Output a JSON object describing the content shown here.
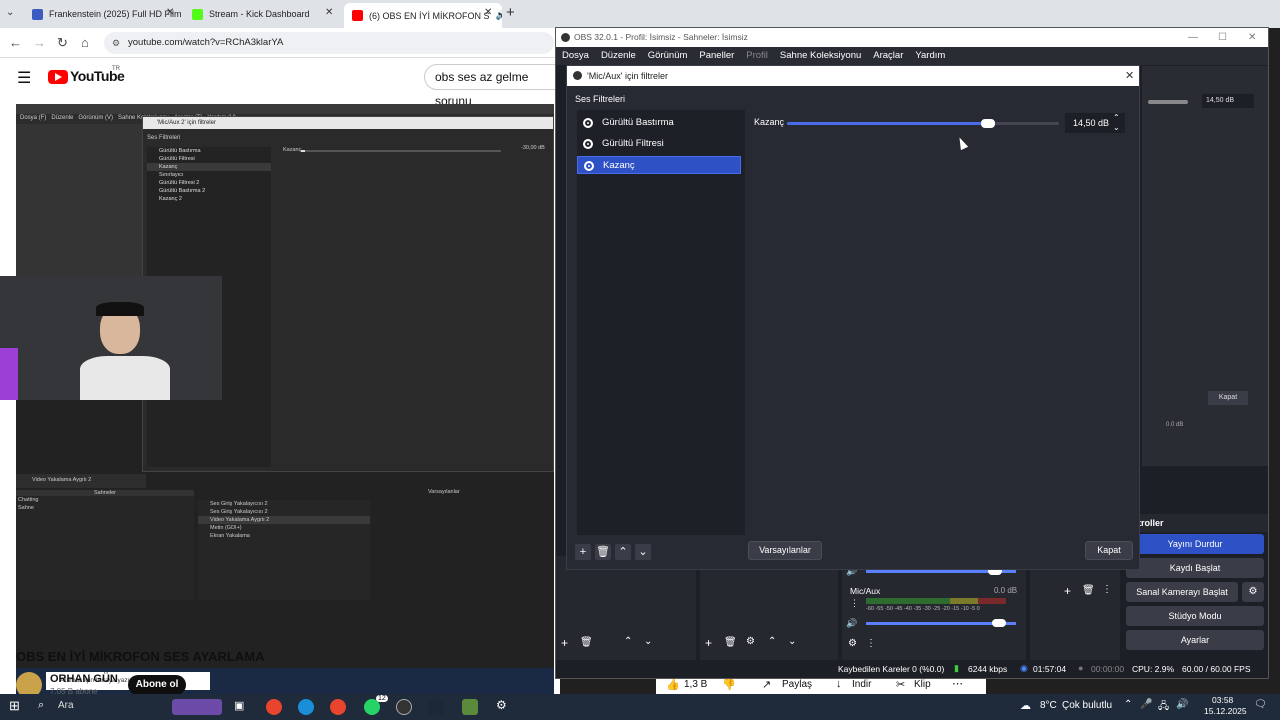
{
  "browser": {
    "tabs": [
      {
        "title": "Frankenstein (2025) Full HD Film",
        "color": "#3a5bbf"
      },
      {
        "title": "Stream - Kick Dashboard",
        "color": "#53fc18"
      },
      {
        "title": "(6) OBS EN İYİ MİKROFON S",
        "color": "#ff0000"
      }
    ],
    "url": "youtube.com/watch?v=RChA3klarYA"
  },
  "youtube": {
    "logo": "YouTube",
    "region": "TR",
    "search_value": "obs ses az gelme sorunu",
    "video_title": "OBS EN İYİ MİKROFON SES AYARLAMA",
    "channel_name": "ORHAN GÜN",
    "channel_subs": "7,05 B abone",
    "subscribe_label": "Abone ol",
    "likes": "1,3 B",
    "share_label": "Paylaş",
    "download_label": "İndir",
    "clip_label": "Klip",
    "video_inner": {
      "dialog_title": "'Mic/Aux 2' için filtreler",
      "section": "Ses Filtreleri",
      "filters": [
        "Gürültü Bastırma",
        "Gürültü Filtresi",
        "Kazanç",
        "Sınırlayıcı",
        "Gürültü Filtresi 2",
        "Gürültü Bastırma 2",
        "Kazanç 2"
      ],
      "gain_label": "Kazanç",
      "gain_value": "-30,00 dB",
      "scene_label": "Video Yakalama Aygıtı 2",
      "scenes_header": "Sahneler",
      "scenes": [
        "Chatting",
        "Sahne"
      ],
      "sources": [
        "Ses Giriş Yakalayıcısı 2",
        "Ses Giriş Yakalayıcısı 2",
        "Video Yakalama Aygıtı 2",
        "Metin (GDI+)",
        "Ekran Yakalama"
      ],
      "defaults_label": "Varsayılanlar",
      "close_label": "Kapat",
      "taskbar_search": "Aramak için buraya yazın"
    }
  },
  "obs": {
    "window_title": "OBS 32.0.1 - Profil: İsimsiz - Sahneler: İsimsiz",
    "menu": [
      "Dosya",
      "Düzenle",
      "Görünüm",
      "Paneller",
      "Profil",
      "Sahne Koleksiyonu",
      "Araçlar",
      "Yardım"
    ],
    "dialog": {
      "title": "'Mic/Aux' için filtreler",
      "section_label": "Ses Filtreleri",
      "filters": [
        {
          "name": "Gürültü Bastırma",
          "selected": false
        },
        {
          "name": "Gürültü Filtresi",
          "selected": false
        },
        {
          "name": "Kazanç",
          "selected": true
        }
      ],
      "gain_label": "Kazanç",
      "gain_value": "14,50 dB",
      "gain_fraction": 0.74,
      "defaults_label": "Varsayılanlar",
      "close_label": "Kapat"
    },
    "mixer": {
      "track_name": "Mic/Aux",
      "track_db": "0.0 dB",
      "scale": "-60 -55 -50 -45 -40 -35 -30 -25 -20 -15 -10 -5 0",
      "bg_right_value": "14,50 dB",
      "bg_right_close": "Kapat",
      "bg_right_db": "0.0 dB"
    },
    "controls": {
      "header": "troller",
      "buttons": [
        "Yayını Durdur",
        "Kaydı Başlat",
        "Sanal Kamerayı Başlat",
        "Stüdyo Modu",
        "Ayarlar"
      ]
    },
    "status": {
      "dropped": "Kaybedilen Kareler 0 (%0.0)",
      "bitrate": "6244 kbps",
      "stream_time": "01:57:04",
      "rec_time": "00:00:00",
      "cpu": "CPU: 2.9%",
      "fps": "60.00 / 60.00 FPS"
    }
  },
  "taskbar": {
    "search": "Ara",
    "weather": "8°C",
    "weather_text": "Çok bulutlu",
    "time": "03:58",
    "date": "15.12.2025",
    "notif_count": "12"
  }
}
